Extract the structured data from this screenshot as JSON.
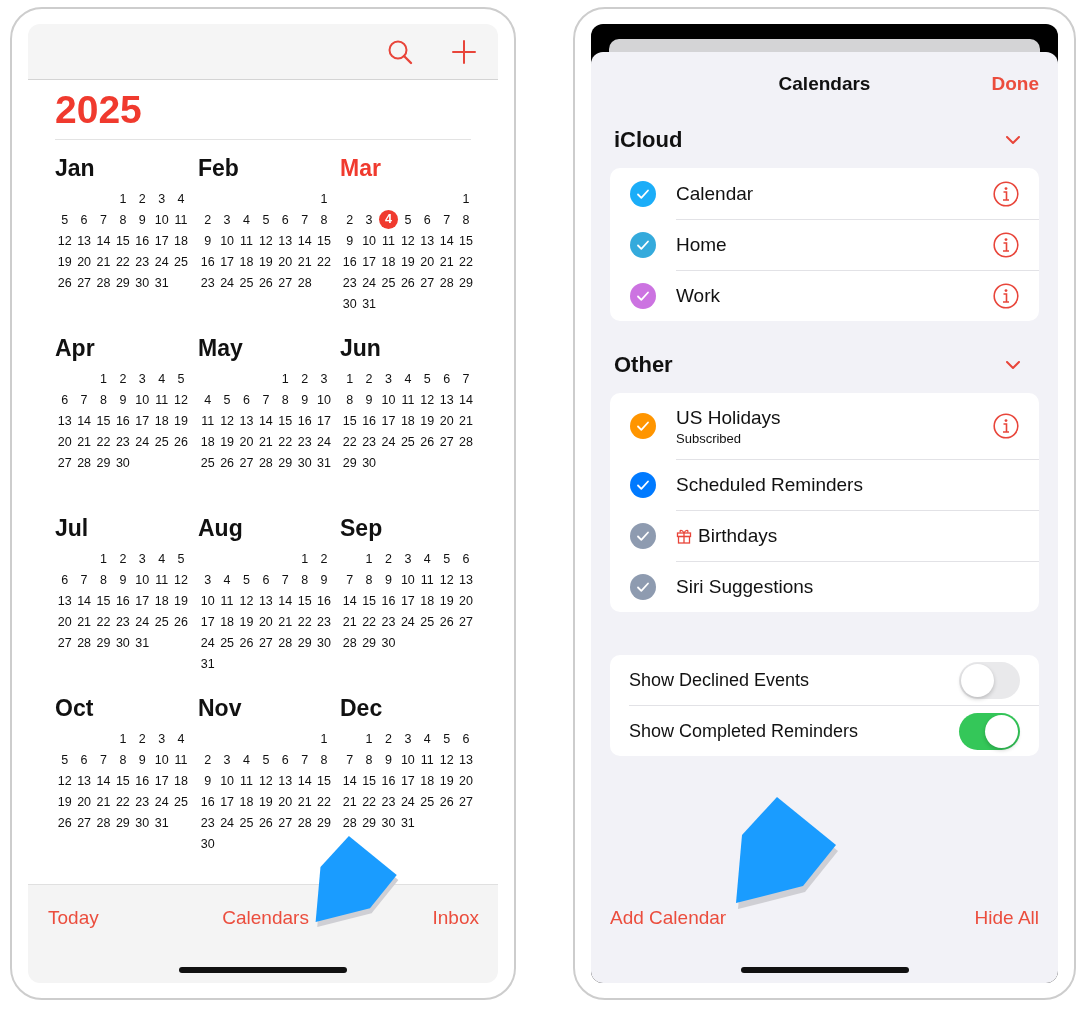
{
  "calendar": {
    "year": "2025",
    "months": [
      {
        "name": "Jan",
        "current": false,
        "weeks": [
          [
            "1",
            "2",
            "3",
            "4"
          ],
          [
            "5",
            "6",
            "7",
            "8",
            "9",
            "10",
            "11"
          ],
          [
            "12",
            "13",
            "14",
            "15",
            "16",
            "17",
            "18"
          ],
          [
            "19",
            "20",
            "21",
            "22",
            "23",
            "24",
            "25"
          ],
          [
            "26",
            "27",
            "28",
            "29",
            "30",
            "31"
          ]
        ]
      },
      {
        "name": "Feb",
        "current": false,
        "weeks": [
          [
            "1"
          ],
          [
            "2",
            "3",
            "4",
            "5",
            "6",
            "7",
            "8"
          ],
          [
            "9",
            "10",
            "11",
            "12",
            "13",
            "14",
            "15"
          ],
          [
            "16",
            "17",
            "18",
            "19",
            "20",
            "21",
            "22"
          ],
          [
            "23",
            "24",
            "25",
            "26",
            "27",
            "28"
          ]
        ]
      },
      {
        "name": "Mar",
        "current": true,
        "weeks": [
          [
            "1"
          ],
          [
            "2",
            "3",
            {
              "day": "4",
              "today": true
            },
            "5",
            "6",
            "7",
            "8"
          ],
          [
            "9",
            "10",
            "11",
            "12",
            "13",
            "14",
            "15"
          ],
          [
            "16",
            "17",
            "18",
            "19",
            "20",
            "21",
            "22"
          ],
          [
            "23",
            "24",
            "25",
            "26",
            "27",
            "28",
            "29"
          ],
          [
            "30",
            "31"
          ]
        ]
      },
      {
        "name": "Apr",
        "current": false,
        "weeks": [
          [
            "1",
            "2",
            "3",
            "4",
            "5"
          ],
          [
            "6",
            "7",
            "8",
            "9",
            "10",
            "11",
            "12"
          ],
          [
            "13",
            "14",
            "15",
            "16",
            "17",
            "18",
            "19"
          ],
          [
            "20",
            "21",
            "22",
            "23",
            "24",
            "25",
            "26"
          ],
          [
            "27",
            "28",
            "29",
            "30"
          ]
        ]
      },
      {
        "name": "May",
        "current": false,
        "weeks": [
          [
            "1",
            "2",
            "3"
          ],
          [
            "4",
            "5",
            "6",
            "7",
            "8",
            "9",
            "10"
          ],
          [
            "11",
            "12",
            "13",
            "14",
            "15",
            "16",
            "17"
          ],
          [
            "18",
            "19",
            "20",
            "21",
            "22",
            "23",
            "24"
          ],
          [
            "25",
            "26",
            "27",
            "28",
            "29",
            "30",
            "31"
          ]
        ]
      },
      {
        "name": "Jun",
        "current": false,
        "weeks": [
          [
            "1",
            "2",
            "3",
            "4",
            "5",
            "6",
            "7"
          ],
          [
            "8",
            "9",
            "10",
            "11",
            "12",
            "13",
            "14"
          ],
          [
            "15",
            "16",
            "17",
            "18",
            "19",
            "20",
            "21"
          ],
          [
            "22",
            "23",
            "24",
            "25",
            "26",
            "27",
            "28"
          ],
          [
            "29",
            "30"
          ]
        ]
      },
      {
        "name": "Jul",
        "current": false,
        "weeks": [
          [
            "1",
            "2",
            "3",
            "4",
            "5"
          ],
          [
            "6",
            "7",
            "8",
            "9",
            "10",
            "11",
            "12"
          ],
          [
            "13",
            "14",
            "15",
            "16",
            "17",
            "18",
            "19"
          ],
          [
            "20",
            "21",
            "22",
            "23",
            "24",
            "25",
            "26"
          ],
          [
            "27",
            "28",
            "29",
            "30",
            "31"
          ]
        ]
      },
      {
        "name": "Aug",
        "current": false,
        "weeks": [
          [
            "1",
            "2"
          ],
          [
            "3",
            "4",
            "5",
            "6",
            "7",
            "8",
            "9"
          ],
          [
            "10",
            "11",
            "12",
            "13",
            "14",
            "15",
            "16"
          ],
          [
            "17",
            "18",
            "19",
            "20",
            "21",
            "22",
            "23"
          ],
          [
            "24",
            "25",
            "26",
            "27",
            "28",
            "29",
            "30"
          ],
          [
            "31"
          ]
        ]
      },
      {
        "name": "Sep",
        "current": false,
        "weeks": [
          [
            "1",
            "2",
            "3",
            "4",
            "5",
            "6"
          ],
          [
            "7",
            "8",
            "9",
            "10",
            "11",
            "12",
            "13"
          ],
          [
            "14",
            "15",
            "16",
            "17",
            "18",
            "19",
            "20"
          ],
          [
            "21",
            "22",
            "23",
            "24",
            "25",
            "26",
            "27"
          ],
          [
            "28",
            "29",
            "30"
          ]
        ]
      },
      {
        "name": "Oct",
        "current": false,
        "weeks": [
          [
            "1",
            "2",
            "3",
            "4"
          ],
          [
            "5",
            "6",
            "7",
            "8",
            "9",
            "10",
            "11"
          ],
          [
            "12",
            "13",
            "14",
            "15",
            "16",
            "17",
            "18"
          ],
          [
            "19",
            "20",
            "21",
            "22",
            "23",
            "24",
            "25"
          ],
          [
            "26",
            "27",
            "28",
            "29",
            "30",
            "31"
          ]
        ]
      },
      {
        "name": "Nov",
        "current": false,
        "weeks": [
          [
            "1"
          ],
          [
            "2",
            "3",
            "4",
            "5",
            "6",
            "7",
            "8"
          ],
          [
            "9",
            "10",
            "11",
            "12",
            "13",
            "14",
            "15"
          ],
          [
            "16",
            "17",
            "18",
            "19",
            "20",
            "21",
            "22"
          ],
          [
            "23",
            "24",
            "25",
            "26",
            "27",
            "28",
            "29"
          ],
          [
            "30"
          ]
        ]
      },
      {
        "name": "Dec",
        "current": false,
        "weeks": [
          [
            "1",
            "2",
            "3",
            "4",
            "5",
            "6"
          ],
          [
            "7",
            "8",
            "9",
            "10",
            "11",
            "12",
            "13"
          ],
          [
            "14",
            "15",
            "16",
            "17",
            "18",
            "19",
            "20"
          ],
          [
            "21",
            "22",
            "23",
            "24",
            "25",
            "26",
            "27"
          ],
          [
            "28",
            "29",
            "30",
            "31"
          ]
        ]
      }
    ],
    "tab_bar": [
      "Today",
      "Calendars",
      "Inbox"
    ]
  },
  "settings": {
    "title": "Calendars",
    "done": "Done",
    "sections": [
      {
        "title": "iCloud",
        "expanded": true,
        "calendars": [
          {
            "name": "Calendar",
            "color": "#1badf8",
            "checked": true,
            "info": true
          },
          {
            "name": "Home",
            "color": "#34aadc",
            "checked": true,
            "info": true
          },
          {
            "name": "Work",
            "color": "#cc73e1",
            "checked": true,
            "info": true
          }
        ]
      },
      {
        "title": "Other",
        "expanded": true,
        "calendars": [
          {
            "name": "US Holidays",
            "subtitle": "Subscribed",
            "color": "#ff9500",
            "checked": true,
            "info": true
          },
          {
            "name": "Scheduled Reminders",
            "color": "#007aff",
            "checked": true,
            "info": false
          },
          {
            "name": "Birthdays",
            "color": "#8e9bb0",
            "checked": true,
            "info": false,
            "gift": true
          },
          {
            "name": "Siri Suggestions",
            "color": "#8e9bb0",
            "checked": true,
            "info": false
          }
        ]
      }
    ],
    "toggles": [
      {
        "label": "Show Declined Events",
        "on": false
      },
      {
        "label": "Show Completed Reminders",
        "on": true
      }
    ],
    "add_calendar": "Add Calendar",
    "hide_all": "Hide All"
  }
}
